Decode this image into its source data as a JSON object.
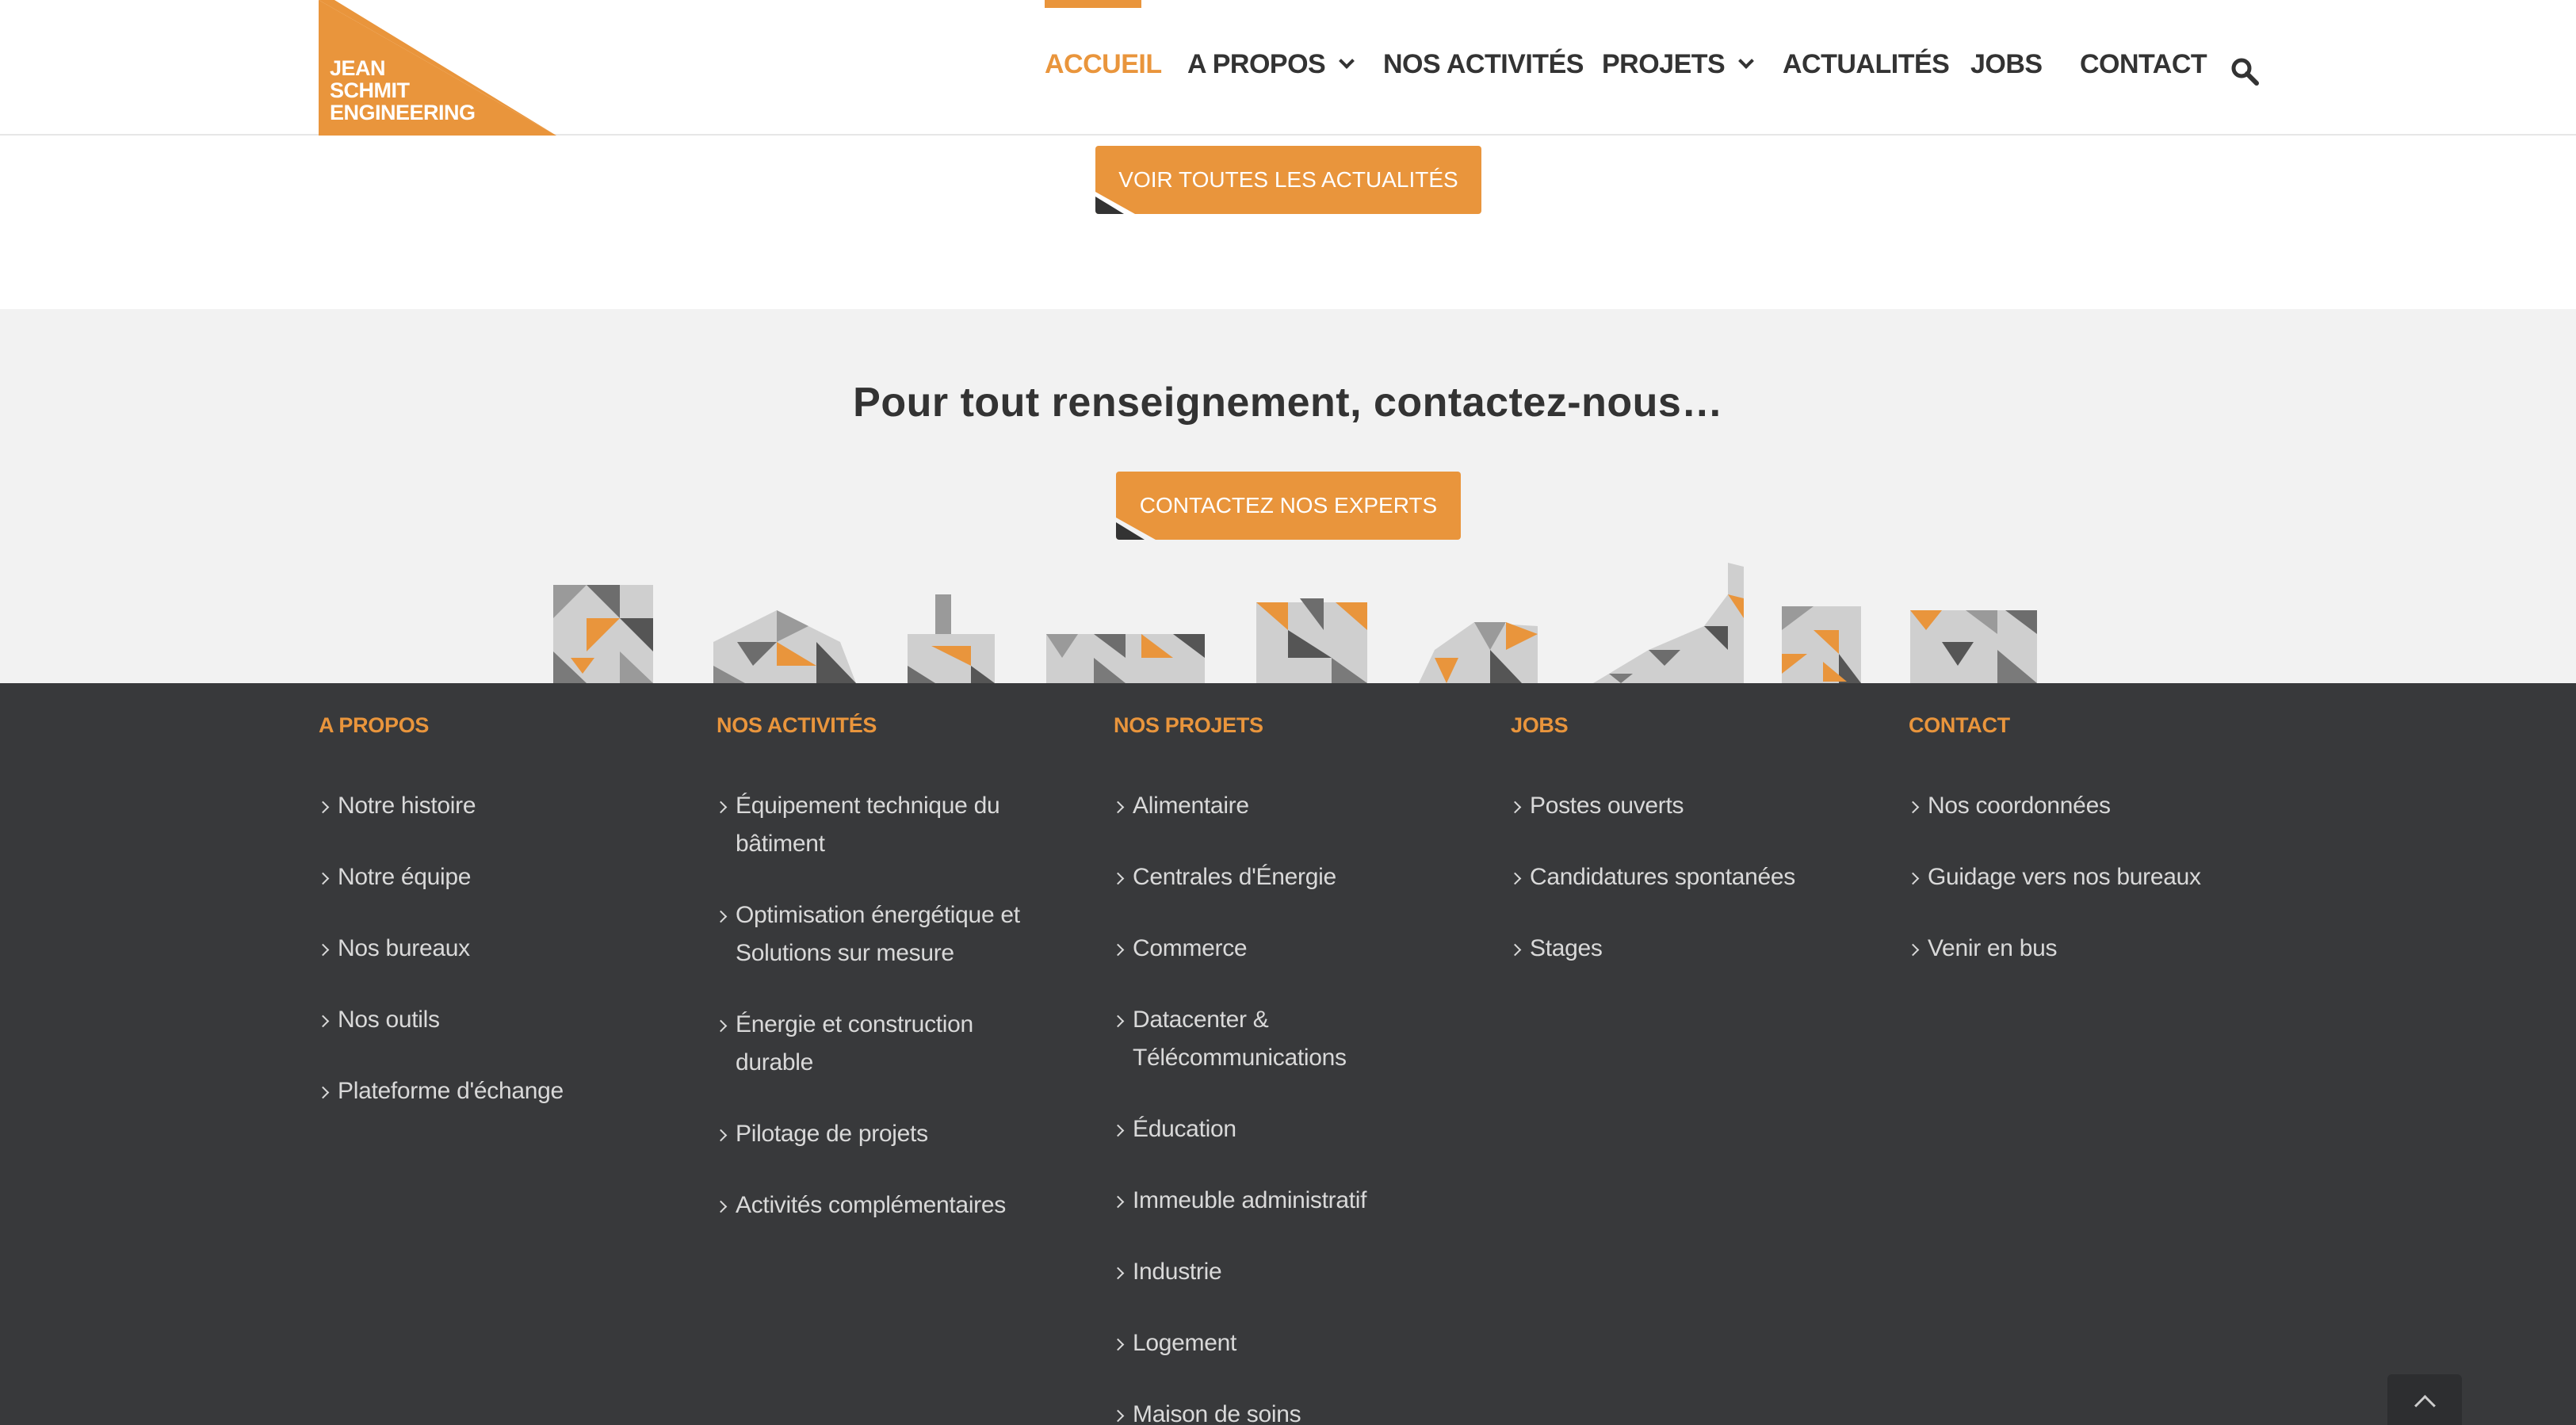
{
  "header": {
    "logo_lines": [
      "JEAN",
      "SCHMIT",
      "ENGINEERING"
    ],
    "nav": [
      {
        "label": "ACCUEIL",
        "active": true,
        "dropdown": false
      },
      {
        "label": "A PROPOS",
        "active": false,
        "dropdown": true
      },
      {
        "label": "NOS ACTIVITÉS",
        "active": false,
        "dropdown": false
      },
      {
        "label": "PROJETS",
        "active": false,
        "dropdown": true
      },
      {
        "label": "ACTUALITÉS",
        "active": false,
        "dropdown": false
      },
      {
        "label": "JOBS",
        "active": false,
        "dropdown": false
      },
      {
        "label": "CONTACT",
        "active": false,
        "dropdown": false
      }
    ],
    "search_icon": "search-icon"
  },
  "news": {
    "button_label": "VOIR TOUTES LES ACTUALITÉS"
  },
  "contact_section": {
    "title": "Pour tout renseignement, contactez-nous…",
    "button_label": "CONTACTEZ NOS EXPERTS"
  },
  "footer": {
    "columns": [
      {
        "title": "A PROPOS",
        "links": [
          "Notre histoire",
          "Notre équipe",
          "Nos bureaux",
          "Nos outils",
          "Plateforme d'échange"
        ]
      },
      {
        "title": "NOS ACTIVITÉS",
        "links": [
          "Équipement technique du bâtiment",
          "Optimisation énergétique et Solutions sur mesure",
          "Énergie et construction durable",
          "Pilotage de projets",
          "Activités complémentaires"
        ]
      },
      {
        "title": "NOS PROJETS",
        "links": [
          "Alimentaire",
          "Centrales d'Énergie",
          "Commerce",
          "Datacenter & Télécommunications",
          "Éducation",
          "Immeuble administratif",
          "Industrie",
          "Logement",
          "Maison de soins"
        ]
      },
      {
        "title": "JOBS",
        "links": [
          "Postes ouverts",
          "Candidatures spontanées",
          "Stages"
        ]
      },
      {
        "title": "CONTACT",
        "links": [
          "Nos coordonnées",
          "Guidage vers nos bureaux",
          "Venir en bus"
        ]
      }
    ]
  },
  "colors": {
    "accent": "#e9953c",
    "footer_bg": "#38393b",
    "contact_bg": "#f2f2f2",
    "text": "#333333"
  }
}
